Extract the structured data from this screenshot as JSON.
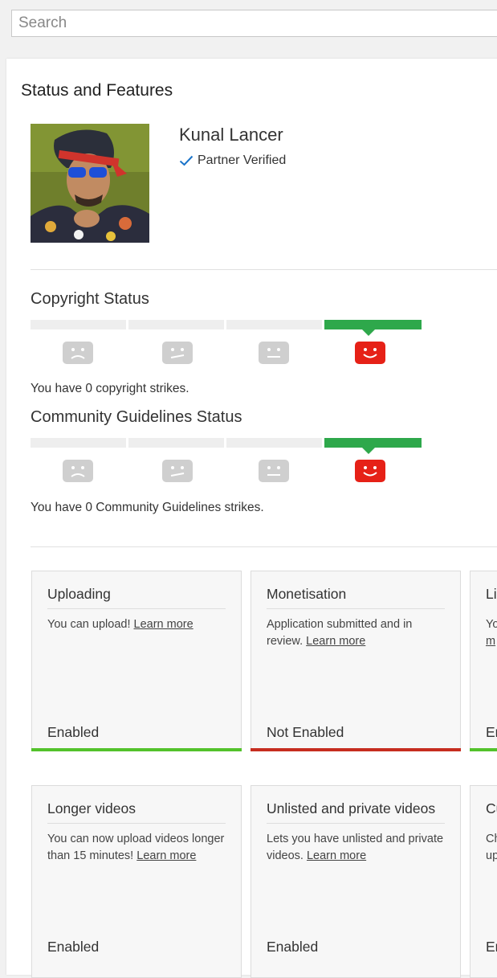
{
  "search": {
    "placeholder": "Search"
  },
  "page": {
    "title": "Status and Features"
  },
  "channel": {
    "name": "Kunal Lancer",
    "verified_label": "Partner Verified"
  },
  "copyright": {
    "title": "Copyright Status",
    "strikes_text": "You have 0 copyright strikes.",
    "strike_count": 0
  },
  "community": {
    "title": "Community Guidelines Status",
    "strikes_text": "You have 0 Community Guidelines strikes.",
    "strike_count": 0
  },
  "colors": {
    "enabled": "#53c22b",
    "not_enabled": "#c62d1f",
    "active_segment": "#2ea84b",
    "happy_face": "#e62117",
    "inactive_face": "#cfcfcf"
  },
  "features_row1": [
    {
      "title": "Uploading",
      "desc": "You can upload!",
      "link": "Learn more",
      "state": "Enabled",
      "status": "enabled"
    },
    {
      "title": "Monetisation",
      "desc": "Application submitted and in review.",
      "link": "Learn more",
      "state": "Not Enabled",
      "status": "not_enabled"
    },
    {
      "title": "Li",
      "desc": "Yo",
      "link": "m",
      "state": "En",
      "status": "enabled"
    }
  ],
  "features_row2": [
    {
      "title": "Longer videos",
      "desc": "You can now upload videos longer than 15 minutes!",
      "link": "Learn more",
      "state": "Enabled"
    },
    {
      "title": "Unlisted and private videos",
      "desc": "Lets you have unlisted and private videos.",
      "link": "Learn more",
      "state": "Enabled"
    },
    {
      "title": "Cu",
      "desc": "Ch up",
      "link": "",
      "state": "En"
    }
  ]
}
